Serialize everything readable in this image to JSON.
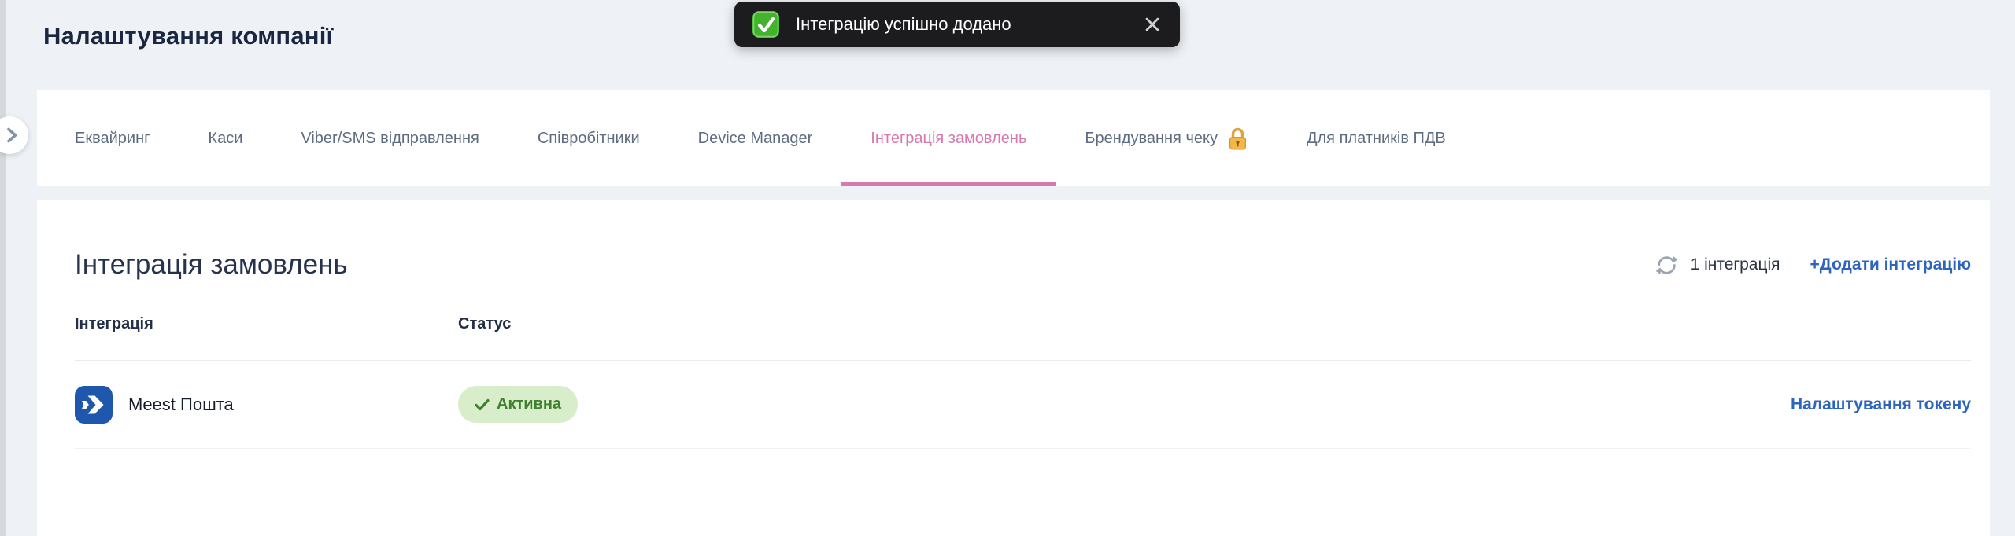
{
  "page_title": "Налаштування компанії",
  "toast": {
    "message": "Інтеграцію успішно додано"
  },
  "tabs": [
    {
      "label": "Еквайринг",
      "active": false
    },
    {
      "label": "Каси",
      "active": false
    },
    {
      "label": "Viber/SMS відправлення",
      "active": false
    },
    {
      "label": "Співробітники",
      "active": false
    },
    {
      "label": "Device Manager",
      "active": false
    },
    {
      "label": "Інтеграція замовлень",
      "active": true
    },
    {
      "label": "Брендування чеку",
      "active": false,
      "locked": true
    },
    {
      "label": "Для платників ПДВ",
      "active": false
    }
  ],
  "section": {
    "title": "Інтеграція замовлень",
    "count_label": "1 інтеграція",
    "add_button": "+Додати інтеграцію"
  },
  "table": {
    "headers": {
      "integration": "Інтеграція",
      "status": "Статус"
    },
    "rows": [
      {
        "name": "Meest Пошта",
        "status": "Активна",
        "action": "Налаштування токену"
      }
    ]
  },
  "icons": {
    "toast_check": "success-check",
    "toast_close": "close-x",
    "tab_lock": "orange-padlock",
    "refresh": "refresh-arrows",
    "expand": "chevron-right",
    "row_logo": "meest-logo",
    "badge_check": "checkmark"
  },
  "colors": {
    "page_background": "#eef1f5",
    "accent_pink": "#d779b0",
    "link_blue": "#2d64bd",
    "badge_background": "#d8edca",
    "badge_text": "#3f8030",
    "toast_background": "#1c1c1f",
    "meest_blue": "#1f57ad",
    "title_navy": "#1b2740"
  }
}
